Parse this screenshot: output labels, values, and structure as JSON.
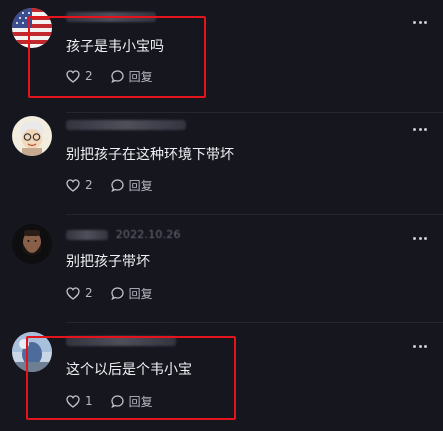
{
  "comments": [
    {
      "meta_text": "",
      "text": "孩子是韦小宝吗",
      "likes": "2",
      "reply_label": "回复",
      "avatar": "us-flag-avatar"
    },
    {
      "meta_text": "",
      "text": "别把孩子在这种环境下带坏",
      "likes": "2",
      "reply_label": "回复",
      "avatar": "cartoon-avatar"
    },
    {
      "meta_text": "2022.10.26",
      "text": "别把孩子带坏",
      "likes": "2",
      "reply_label": "回复",
      "avatar": "bearded-man-avatar"
    },
    {
      "meta_text": "",
      "text": "这个以后是个韦小宝",
      "likes": "1",
      "reply_label": "回复",
      "avatar": "landscape-avatar"
    }
  ],
  "colors": {
    "background": "#16161f",
    "highlight": "#e3141b",
    "text": "#f0f0f4",
    "muted": "#7b7b88"
  }
}
